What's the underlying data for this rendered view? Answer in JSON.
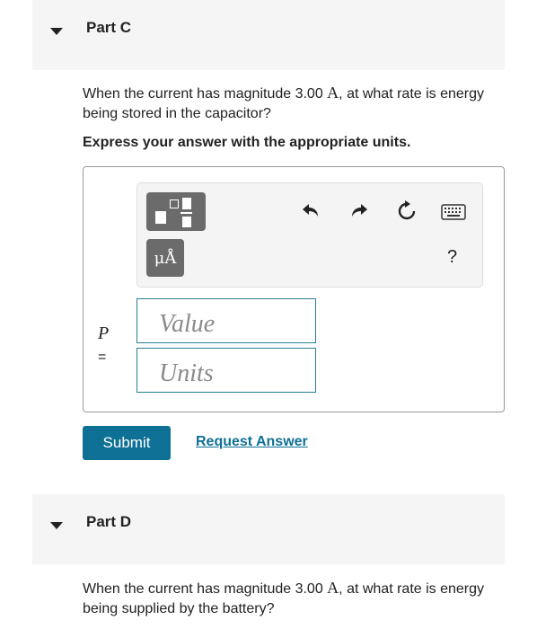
{
  "part_c": {
    "title": "Part C",
    "question_pre": "When the current has magnitude 3.00 ",
    "question_unit": "A",
    "question_post": ", at what rate is energy being stored in the capacitor?",
    "instruction": "Express your answer with the appropriate units.",
    "toolbar": {
      "units_label": "μÅ",
      "help_label": "?",
      "icons": [
        "templates-icon",
        "undo-icon",
        "redo-icon",
        "reset-icon",
        "keyboard-icon",
        "units-icon"
      ]
    },
    "answer": {
      "variable": "P",
      "equals": "=",
      "value_placeholder": "Value",
      "units_placeholder": "Units"
    },
    "submit_label": "Submit",
    "request_answer_label": "Request Answer"
  },
  "part_d": {
    "title": "Part D",
    "question_pre": "When the current has magnitude 3.00 ",
    "question_unit": "A",
    "question_post": ", at what rate is energy being supplied by the battery?"
  },
  "colors": {
    "header_bg": "#f5f5f5",
    "accent": "#0f7096",
    "field_border": "#2a7f96"
  }
}
